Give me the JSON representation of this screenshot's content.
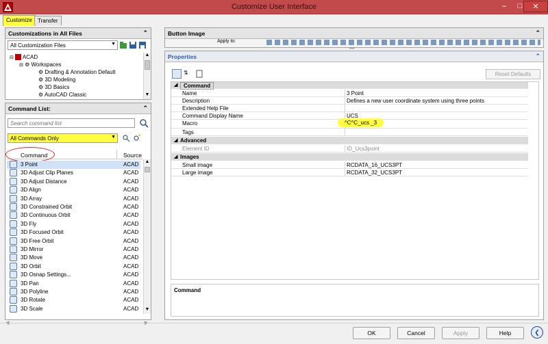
{
  "window": {
    "title": "Customize User Interface"
  },
  "tabs": [
    {
      "label": "Customize"
    },
    {
      "label": "Transfer"
    }
  ],
  "customizations": {
    "heading": "Customizations in All Files",
    "file_combo": "All Customization Files",
    "tree": [
      {
        "label": "ACAD"
      },
      {
        "label": "Workspaces"
      },
      {
        "label": "Drafting & Annotation Default"
      },
      {
        "label": "3D Modeling"
      },
      {
        "label": "3D Basics"
      },
      {
        "label": "AutoCAD Classic"
      }
    ]
  },
  "command_list": {
    "heading": "Command List:",
    "search_placeholder": "Search command list",
    "filter": "All Commands Only",
    "columns": {
      "command": "Command",
      "source": "Source"
    },
    "rows": [
      {
        "name": "3 Point",
        "source": "ACAD"
      },
      {
        "name": "3D Adjust Clip Planes",
        "source": "ACAD"
      },
      {
        "name": "3D Adjust Distance",
        "source": "ACAD"
      },
      {
        "name": "3D Align",
        "source": "ACAD"
      },
      {
        "name": "3D Array",
        "source": "ACAD"
      },
      {
        "name": "3D Constrained Orbit",
        "source": "ACAD"
      },
      {
        "name": "3D Continuous Orbit",
        "source": "ACAD"
      },
      {
        "name": "3D Fly",
        "source": "ACAD"
      },
      {
        "name": "3D Focused Orbit",
        "source": "ACAD"
      },
      {
        "name": "3D Free Orbit",
        "source": "ACAD"
      },
      {
        "name": "3D Mirror",
        "source": "ACAD"
      },
      {
        "name": "3D Move",
        "source": "ACAD"
      },
      {
        "name": "3D Orbit",
        "source": "ACAD"
      },
      {
        "name": "3D Osnap Settings...",
        "source": "ACAD"
      },
      {
        "name": "3D Pan",
        "source": "ACAD"
      },
      {
        "name": "3D Polyline",
        "source": "ACAD"
      },
      {
        "name": "3D Rotate",
        "source": "ACAD"
      },
      {
        "name": "3D Scale",
        "source": "ACAD"
      }
    ]
  },
  "button_image": {
    "heading": "Button Image",
    "apply_to": "Apply to:"
  },
  "properties": {
    "heading": "Properties",
    "reset": "Reset Defaults",
    "categories": [
      {
        "name": "Command",
        "rows": [
          {
            "key": "Name",
            "value": "3 Point"
          },
          {
            "key": "Description",
            "value": "Defines a new user coordinate system using three points"
          },
          {
            "key": "Extended Help File",
            "value": ""
          },
          {
            "key": "Command Display Name",
            "value": "UCS"
          },
          {
            "key": "Macro",
            "value": "^C^C_ucs _3"
          },
          {
            "key": "Tags",
            "value": ""
          }
        ]
      },
      {
        "name": "Advanced",
        "rows": [
          {
            "key": "Element ID",
            "value": "ID_Ucs3point"
          }
        ]
      },
      {
        "name": "Images",
        "rows": [
          {
            "key": "Small image",
            "value": "RCDATA_16_UCS3PT"
          },
          {
            "key": "Large image",
            "value": "RCDATA_32_UCS3PT"
          }
        ]
      }
    ],
    "help_heading": "Command"
  },
  "buttons": {
    "ok": "OK",
    "cancel": "Cancel",
    "apply": "Apply",
    "help": "Help"
  },
  "colors": {
    "title_bar": "#c24a4a",
    "highlight": "#ffff40",
    "annotation": "#e02020"
  }
}
